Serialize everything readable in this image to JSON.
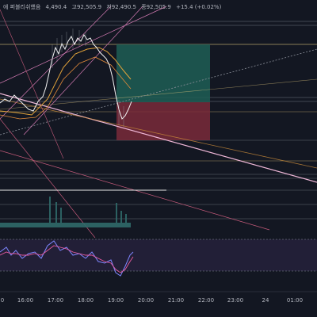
{
  "header": {
    "symbol": "에 퍼블리쉬했음",
    "open": "4,490.4",
    "high": "고92,505.9",
    "low": "저92,490.5",
    "close": "종92,505.9",
    "change": "+15.4 (+0.02%)"
  },
  "x_ticks": [
    "0",
    "16:00",
    "17:00",
    "18:00",
    "19:00",
    "20:00",
    "21:00",
    "22:00",
    "23:00",
    "24",
    "01:00"
  ],
  "colors": {
    "background": "#131722",
    "price_line": "#f5f5f5",
    "ma_orange": "#e0a23a",
    "trend_pink": "#d27ab2",
    "long_zone": "#1e5e55",
    "short_zone": "#7a2a3a",
    "stoch_fill": "#2a2440",
    "stoch_k": "#7f86ff",
    "stoch_d": "#e85aa0"
  }
}
